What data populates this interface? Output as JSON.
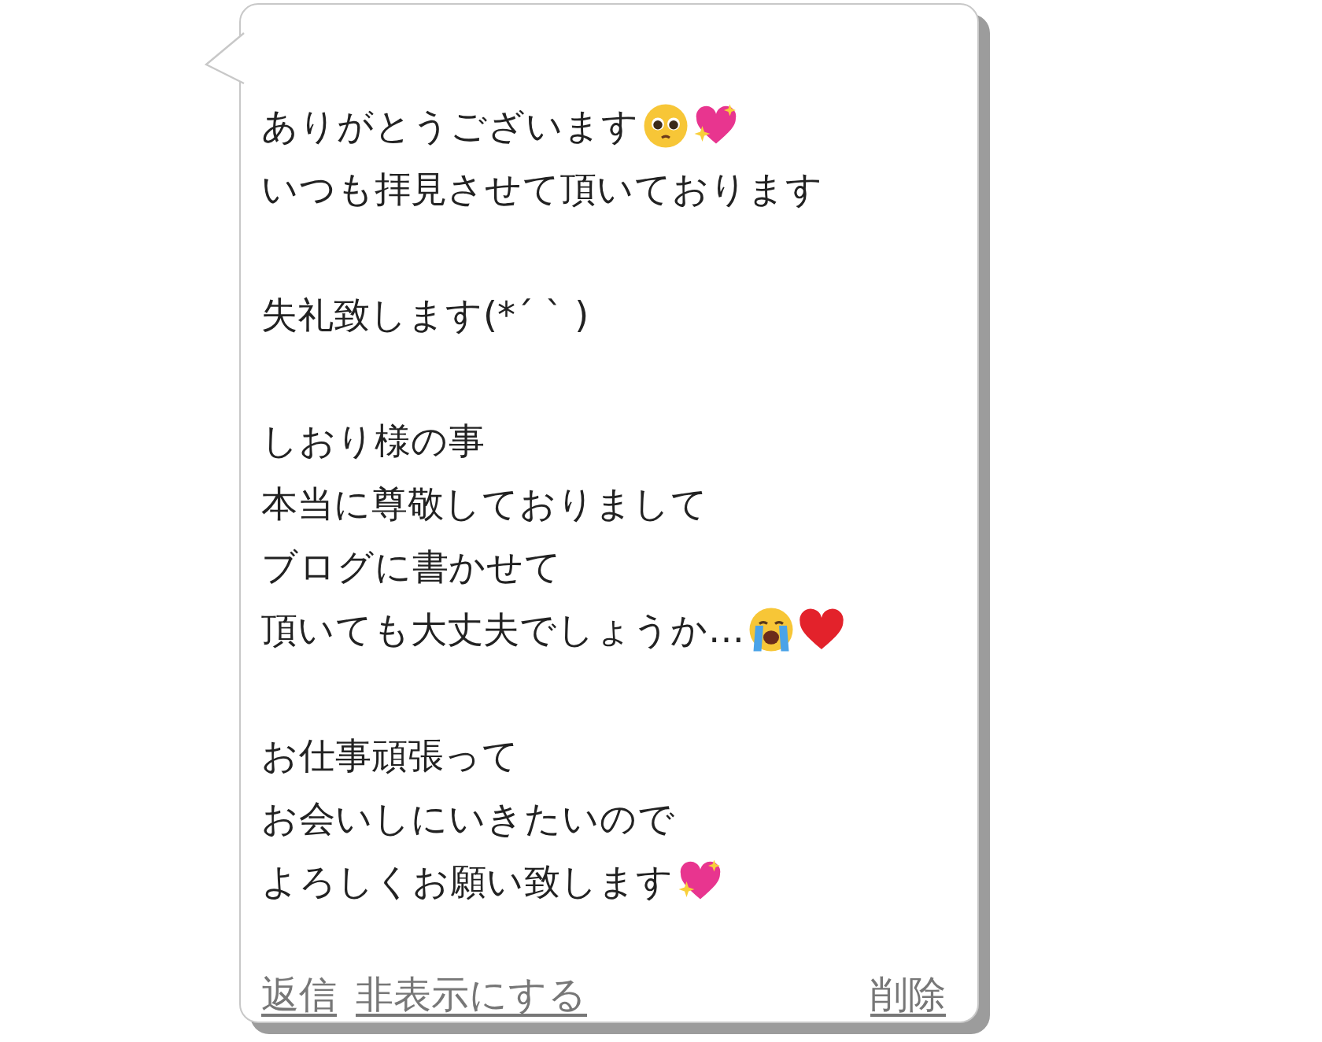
{
  "message": {
    "paragraphs": [
      {
        "lines": [
          {
            "text": "ありがとうございます",
            "emoji": [
              {
                "kind": "pleading"
              },
              {
                "kind": "sparkling"
              }
            ]
          },
          {
            "text": "いつも拝見させて頂いております"
          }
        ]
      },
      {
        "lines": [
          {
            "text": "失礼致します(*´ ` )"
          }
        ]
      },
      {
        "lines": [
          {
            "text": "しおり様の事"
          },
          {
            "text": "本当に尊敬しておりまして"
          },
          {
            "text": "ブログに書かせて"
          },
          {
            "text": "頂いても大丈夫でしょうか…",
            "emoji": [
              {
                "kind": "crying"
              },
              {
                "kind": "heart"
              }
            ]
          }
        ]
      },
      {
        "lines": [
          {
            "text": "お仕事頑張って"
          },
          {
            "text": "お会いしにいきたいので"
          },
          {
            "text": "よろしくお願い致します",
            "emoji": [
              {
                "kind": "sparkling"
              }
            ]
          }
        ]
      }
    ]
  },
  "left_actions": [
    {
      "label": "返信"
    },
    {
      "label": "非表示にする"
    }
  ],
  "right_actions": [
    {
      "label": "削除"
    }
  ]
}
